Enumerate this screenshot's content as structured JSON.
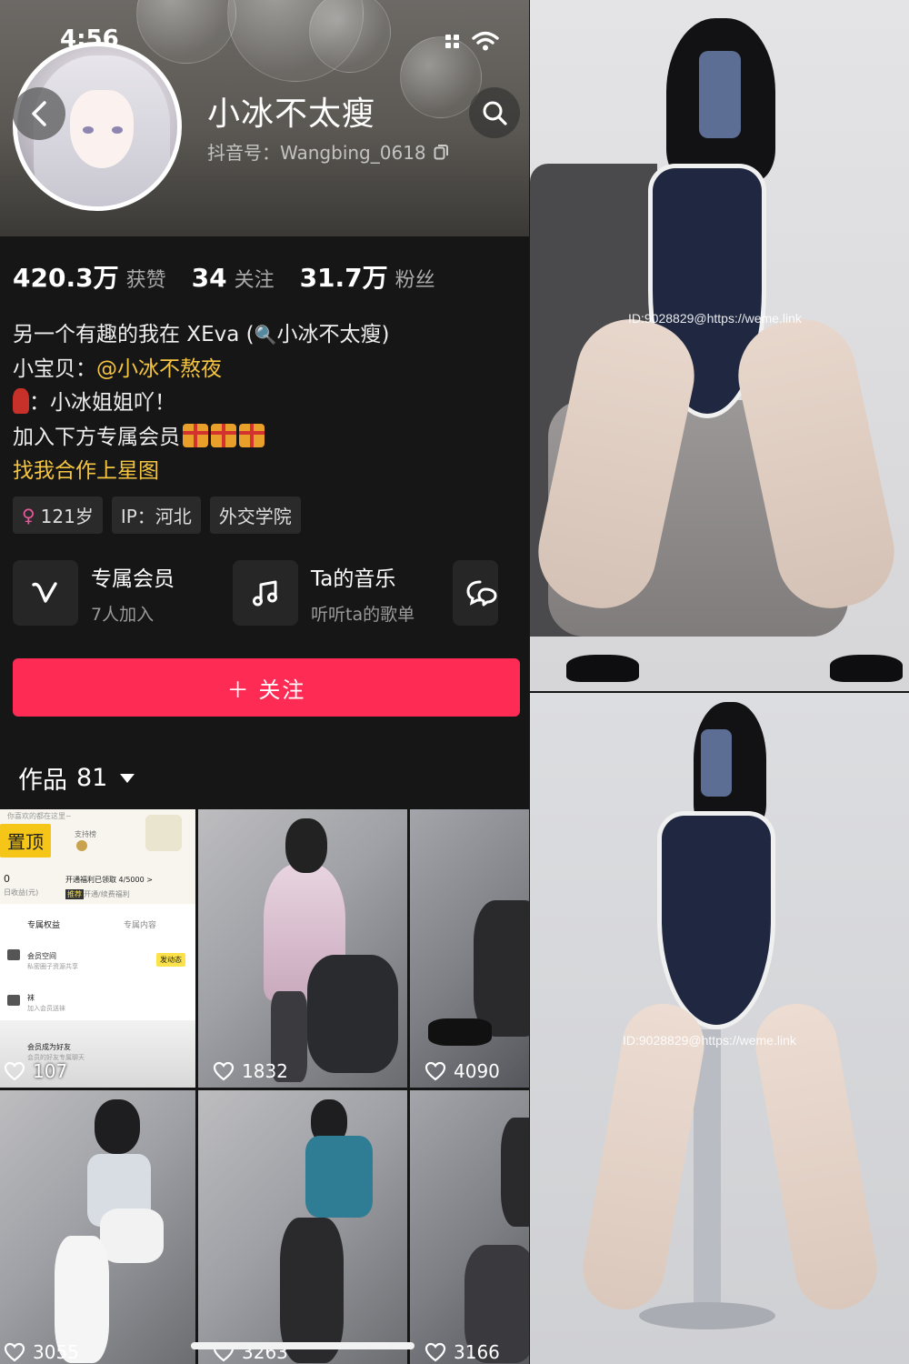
{
  "status_bar": {
    "time": "4:56"
  },
  "profile": {
    "name": "小冰不太瘦",
    "douyin_id": "抖音号：Wangbing_0618"
  },
  "stats": [
    {
      "value": "420.3万",
      "label": "获赞"
    },
    {
      "value": "34",
      "label": "关注"
    },
    {
      "value": "31.7万",
      "label": "粉丝"
    }
  ],
  "bio": {
    "line1_prefix": "另一个有趣的我在 XEva (",
    "line1_suffix": "小冰不太瘦)",
    "line2_prefix": "小宝贝：",
    "line2_mention": "@小冰不熬夜",
    "line3": "：小冰姐姐吖！",
    "line4": "加入下方专属会员",
    "line5": "找我合作上星图"
  },
  "tags": [
    {
      "label": "121岁",
      "icon": "female-icon"
    },
    {
      "label": "IP：河北"
    },
    {
      "label": "外交学院"
    }
  ],
  "cards": [
    {
      "title": "专属会员",
      "subtitle": "7人加入",
      "icon": "vip-v-icon"
    },
    {
      "title": "Ta的音乐",
      "subtitle": "听听ta的歌单",
      "icon": "music-note-icon"
    },
    {
      "icon": "chat-bubble-icon"
    }
  ],
  "follow_button": {
    "label": "＋ 关注"
  },
  "works": {
    "label": "作品",
    "count": "81"
  },
  "grid": {
    "pinned_label": "置顶",
    "pinned_mini": {
      "line_top": "你喜欢的都在这里~",
      "support": "支持榜",
      "zero": "0",
      "earned": "日收益(元)",
      "welfare": "开通福利已领取 4/5000 >",
      "welfare_tag": "推荐",
      "welfare_sub": "开通/续费福利",
      "tab1": "专属权益",
      "tab2": "专属内容",
      "item1": "会员空间",
      "item1_sub": "私密圈子资源共享",
      "item1_btn": "发动态",
      "item2": "袜",
      "item2_sub": "加入会员送袜",
      "item3": "会员成为好友",
      "item3_sub": "会员的好友专属聊天"
    },
    "likes": [
      "107",
      "1832",
      "4090",
      "3055",
      "3263",
      "3166"
    ]
  },
  "right_photos": {
    "watermark_top": "ID:9028829@https://weme.link",
    "watermark_bottom": "ID:9028829@https://weme.link"
  },
  "colors": {
    "accent": "#fe2c55",
    "mention": "#f5c542",
    "background": "#161616"
  }
}
